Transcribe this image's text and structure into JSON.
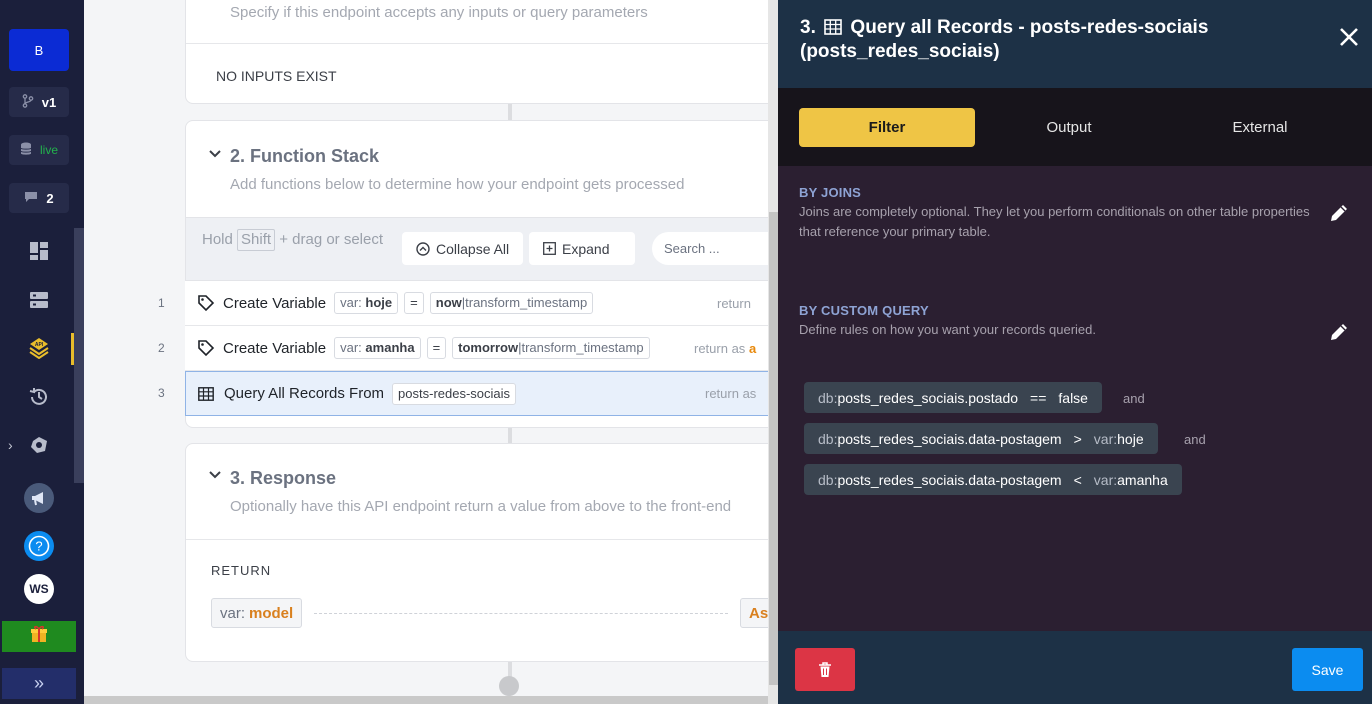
{
  "rail": {
    "workspace_letter": "B",
    "version_label": "v1",
    "live_label": "live",
    "comments_count": "2",
    "user_initials": "WS"
  },
  "card_inputs": {
    "subtitle": "Specify if this endpoint accepts any inputs or query parameters",
    "empty_text": "NO INPUTS EXIST"
  },
  "card_functions": {
    "title": "2. Function Stack",
    "subtitle": "Add functions below to determine how your endpoint gets processed",
    "hold_prefix": "Hold",
    "hold_key": "Shift",
    "hold_suffix": "+ drag or select",
    "collapse_label": "Collapse All",
    "expand_label": "Expand",
    "search_placeholder": "Search ..."
  },
  "functions": [
    {
      "num": "1",
      "name": "Create Variable",
      "var_prefix": "var:",
      "var_name": "hoje",
      "eq": "=",
      "value_bold": "now",
      "value_rest": "|transform_timestamp",
      "return_text": "return",
      "return_hl": ""
    },
    {
      "num": "2",
      "name": "Create Variable",
      "var_prefix": "var:",
      "var_name": "amanha",
      "eq": "=",
      "value_bold": "tomorrow",
      "value_rest": "|transform_timestamp",
      "return_text": "return as",
      "return_hl": "a"
    },
    {
      "num": "3",
      "name": "Query All Records From",
      "table": "posts-redes-sociais",
      "return_text": "return as",
      "return_hl": ""
    }
  ],
  "card_response": {
    "title": "3. Response",
    "subtitle": "Optionally have this API endpoint return a value from above to the front-end",
    "return_label": "RETURN",
    "ret_prefix": "var:",
    "ret_var": "model",
    "as_label": "As"
  },
  "panel": {
    "title_prefix": "3.",
    "title_main": "Query all Records - posts-redes-sociais",
    "title_sub": "(posts_redes_sociais)",
    "tabs": [
      "Filter",
      "Output",
      "External"
    ],
    "joins_title": "BY JOINS",
    "joins_desc": "Joins are completely optional. They let you perform conditionals on other table properties that reference your primary table.",
    "custom_title": "BY CUSTOM QUERY",
    "custom_desc": "Define rules on how you want your records queried.",
    "conditions": [
      {
        "lhs_prefix": "db:",
        "lhs": "posts_redes_sociais.postado",
        "op": "==",
        "rhs_prefix": "",
        "rhs": "false",
        "join": "and"
      },
      {
        "lhs_prefix": "db:",
        "lhs": "posts_redes_sociais.data-postagem",
        "op": ">",
        "rhs_prefix": "var:",
        "rhs": "hoje",
        "join": "and"
      },
      {
        "lhs_prefix": "db:",
        "lhs": "posts_redes_sociais.data-postagem",
        "op": "<",
        "rhs_prefix": "var:",
        "rhs": "amanha",
        "join": ""
      }
    ],
    "save_label": "Save"
  },
  "colors": {
    "rail_bg": "#1b1f3b",
    "panel_bg": "#2b1f31",
    "panel_head": "#1d3146",
    "accent_tab": "#efc545",
    "save_blue": "#0b8cf0",
    "delete_red": "#dc3545",
    "var_orange": "#d9801f"
  }
}
